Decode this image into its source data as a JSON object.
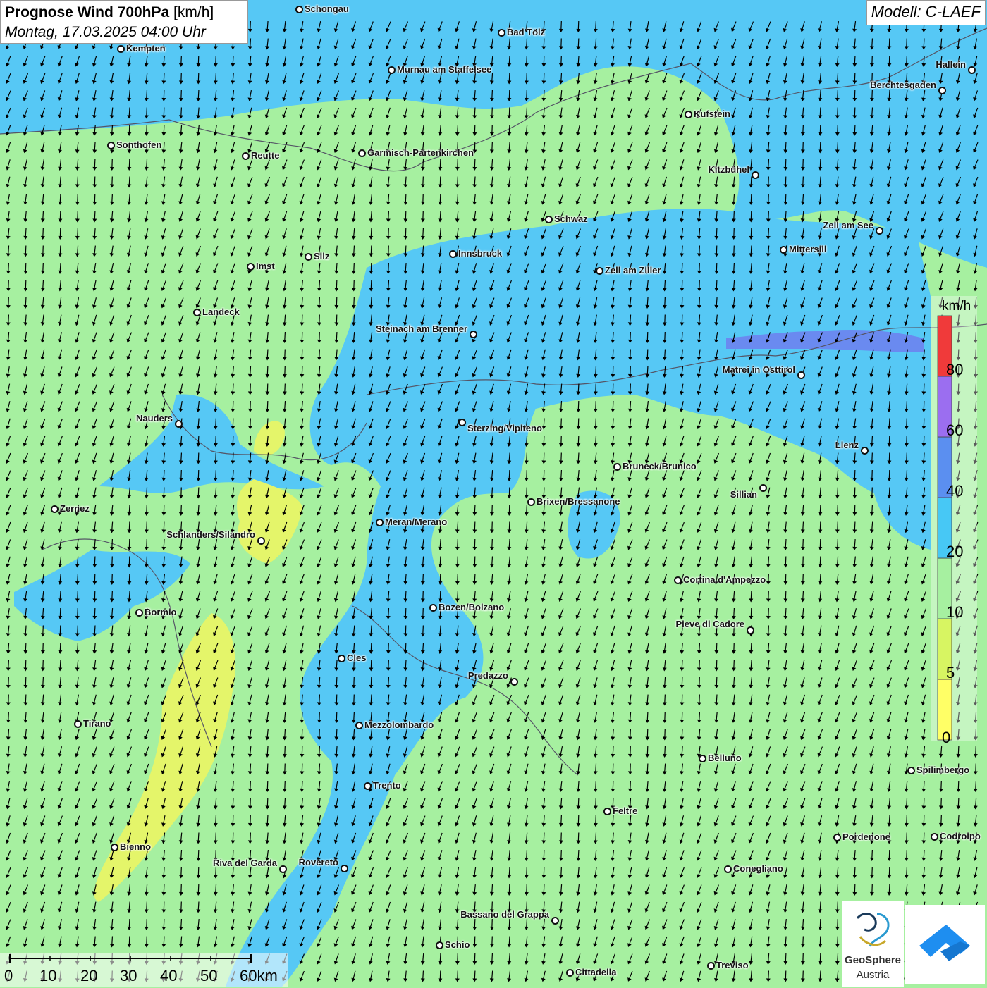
{
  "title": {
    "bold": "Prognose Wind 700hPa",
    "unit": "[km/h]",
    "date": "Montag, 17.03.2025 04:00 Uhr"
  },
  "model": "Modell: C-LAEF",
  "wind_direction": "north-northwest (arrows pointing south)",
  "legend": {
    "unit": "km/h",
    "labels": [
      "0",
      "5",
      "10",
      "20",
      "40",
      "60",
      "80"
    ],
    "colors": [
      "#ffff66",
      "#d7f562",
      "#a6f0a0",
      "#47c8f5",
      "#5b8ff0",
      "#9b6ef0",
      "#f03a3a"
    ]
  },
  "colors": {
    "land_calm": "#a6f0a0",
    "wind_blue": "#56c8f5",
    "wind_strong": "#6a8af0",
    "weak_yellow": "#e4f56a"
  },
  "cities": [
    {
      "name": "Schongau"
    },
    {
      "name": "Bad Tölz"
    },
    {
      "name": "Kempten"
    },
    {
      "name": "Hallein"
    },
    {
      "name": "Murnau am Staffelsee"
    },
    {
      "name": "Berchtesgaden"
    },
    {
      "name": "Kufstein"
    },
    {
      "name": "Sonthofen"
    },
    {
      "name": "Reutte"
    },
    {
      "name": "Garmisch-Partenkirchen"
    },
    {
      "name": "Kitzbühel"
    },
    {
      "name": "Schwaz"
    },
    {
      "name": "Zell am See"
    },
    {
      "name": "Mittersill"
    },
    {
      "name": "Innsbruck"
    },
    {
      "name": "Silz"
    },
    {
      "name": "Imst"
    },
    {
      "name": "Zell am Ziller"
    },
    {
      "name": "Landeck"
    },
    {
      "name": "Steinach am Brenner"
    },
    {
      "name": "Matrei in Osttirol"
    },
    {
      "name": "Nauders"
    },
    {
      "name": "Sterzing/Vipiteno"
    },
    {
      "name": "Lienz"
    },
    {
      "name": "Bruneck/Brunico"
    },
    {
      "name": "Sillian"
    },
    {
      "name": "Brixen/Bressanone"
    },
    {
      "name": "Zernez"
    },
    {
      "name": "Meran/Merano"
    },
    {
      "name": "Schlanders/Silandro"
    },
    {
      "name": "Cortina d'Ampezzo"
    },
    {
      "name": "Bozen/Bolzano"
    },
    {
      "name": "Bormio"
    },
    {
      "name": "Pieve di Cadore"
    },
    {
      "name": "Cles"
    },
    {
      "name": "Predazzo"
    },
    {
      "name": "Tirano"
    },
    {
      "name": "Mezzolombardo"
    },
    {
      "name": "Belluno"
    },
    {
      "name": "Spilimbergo"
    },
    {
      "name": "Trento"
    },
    {
      "name": "Feltre"
    },
    {
      "name": "Pordenone"
    },
    {
      "name": "Codroipo"
    },
    {
      "name": "Bienno"
    },
    {
      "name": "Riva del Garda"
    },
    {
      "name": "Rovereto"
    },
    {
      "name": "Conegliano"
    },
    {
      "name": "Bassano del Grappa"
    },
    {
      "name": "Schio"
    },
    {
      "name": "Treviso"
    },
    {
      "name": "Cittadella"
    }
  ],
  "scale": {
    "labels": [
      "0",
      "10",
      "20",
      "30",
      "40",
      "50",
      "60km"
    ]
  },
  "logos": {
    "geosphere_line1": "GeoSphere",
    "geosphere_line2": "Austria"
  }
}
